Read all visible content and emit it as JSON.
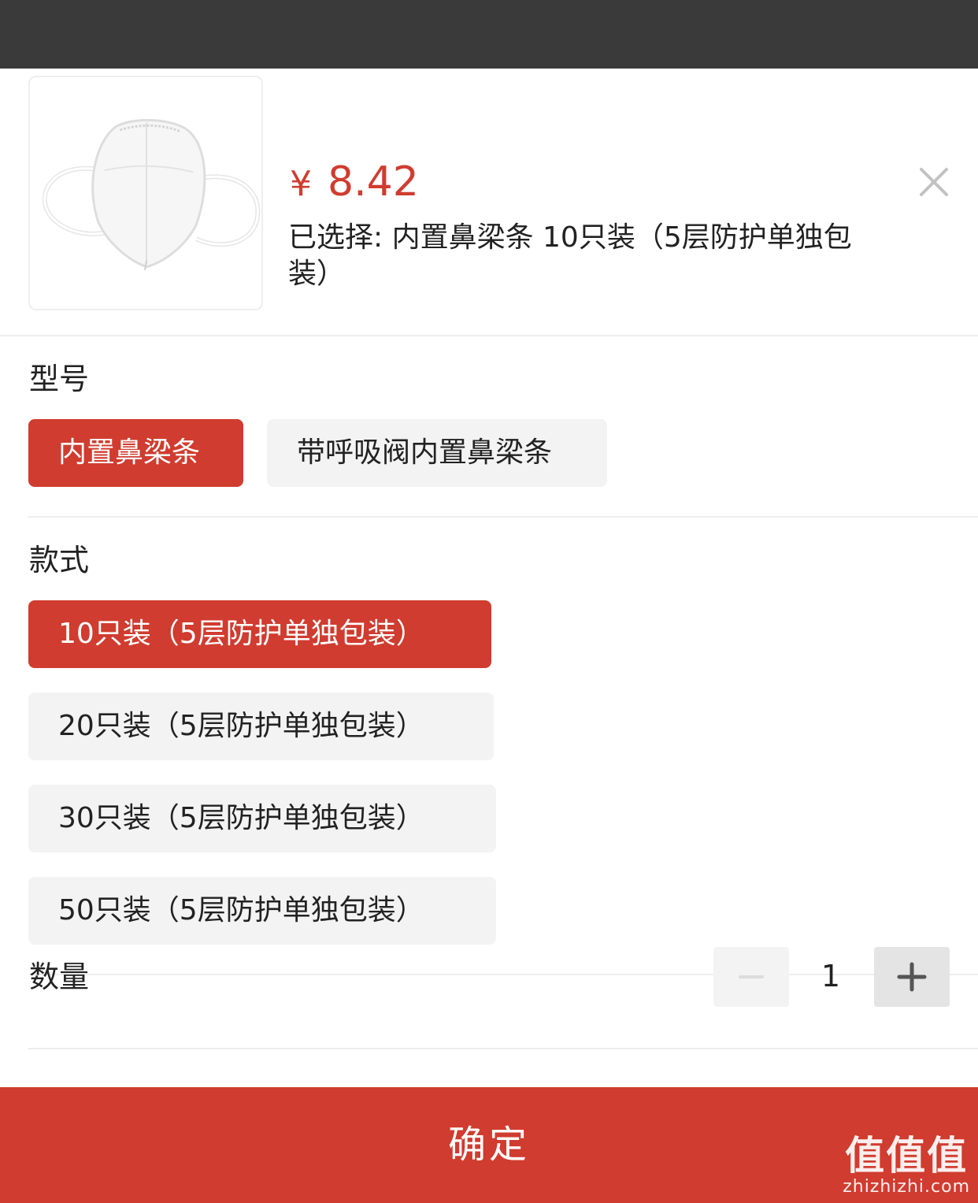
{
  "product": {
    "image_icon": "mask-product-image",
    "currency": "¥",
    "price": "8.42",
    "selected_text": "已选择: 内置鼻梁条 10只装（5层防护单独包装）"
  },
  "sections": {
    "model": {
      "title": "型号",
      "options": [
        "内置鼻梁条",
        "带呼吸阀内置鼻梁条"
      ],
      "selected_index": 0
    },
    "style": {
      "title": "款式",
      "options": [
        "10只装（5层防护单独包装）",
        "20只装（5层防护单独包装）",
        "30只装（5层防护单独包装）",
        "50只装（5层防护单独包装）"
      ],
      "selected_index": 0
    }
  },
  "quantity": {
    "label": "数量",
    "value": "1",
    "minus_icon": "minus-icon",
    "plus_icon": "plus-icon"
  },
  "footer": {
    "confirm_label": "确定",
    "watermark_big": "值值值",
    "watermark_small": "zhizhizhi.com"
  },
  "colors": {
    "accent": "#d03c2f",
    "option_bg": "#f3f3f3",
    "topbar": "#3a3a3a"
  }
}
